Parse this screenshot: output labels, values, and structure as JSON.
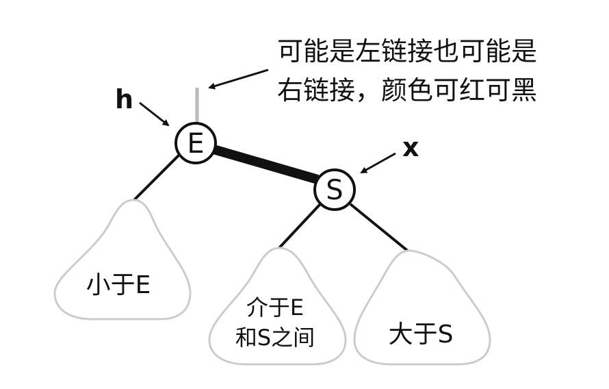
{
  "annotation": {
    "line1": "可能是左链接也可能是",
    "line2": "右链接，颜色可红可黑"
  },
  "pointers": {
    "h": "h",
    "x": "x"
  },
  "nodes": {
    "e": "E",
    "s": "S"
  },
  "subtrees": {
    "left": "小于E",
    "middle_line1": "介于E",
    "middle_line2": "和S之间",
    "right": "大于S"
  },
  "colors": {
    "stroke": "#111111",
    "parent_link": "#bbbbbb",
    "subtree_stroke": "#cccccc"
  }
}
